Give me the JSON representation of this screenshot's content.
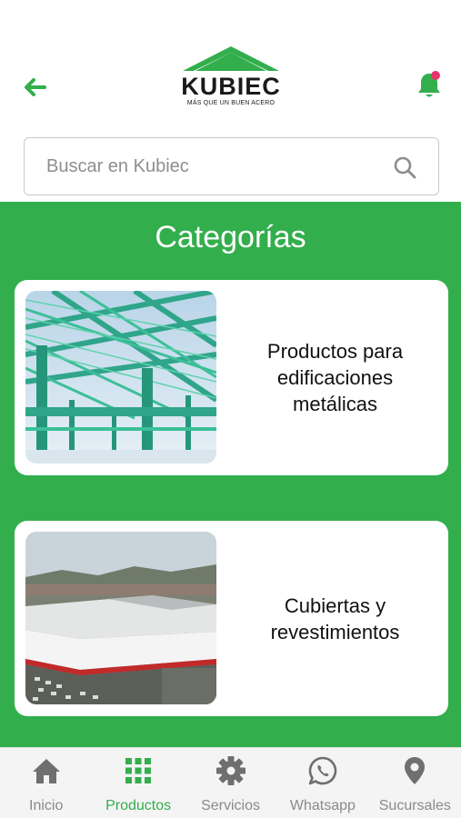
{
  "brand": {
    "name": "KUBIEC",
    "tagline": "MÁS QUE UN BUEN ACERO",
    "green": "#33ae4d",
    "notification_dot": "#e8326e"
  },
  "header": {
    "back_icon": "arrow-left-icon",
    "bell_icon": "bell-icon"
  },
  "search": {
    "placeholder": "Buscar en Kubiec",
    "value": "",
    "icon": "search-icon"
  },
  "categories": {
    "title": "Categorías",
    "items": [
      {
        "label": "Productos para edificaciones metálicas",
        "image": "steel-structure-photo"
      },
      {
        "label": "Cubiertas y revestimientos",
        "image": "industrial-warehouse-photo"
      }
    ]
  },
  "nav": {
    "items": [
      {
        "label": "Inicio",
        "icon": "home-icon",
        "active": false
      },
      {
        "label": "Productos",
        "icon": "grid-icon",
        "active": true
      },
      {
        "label": "Servicios",
        "icon": "gear-icon",
        "active": false
      },
      {
        "label": "Whatsapp",
        "icon": "whatsapp-icon",
        "active": false
      },
      {
        "label": "Sucursales",
        "icon": "location-pin-icon",
        "active": false
      }
    ]
  }
}
